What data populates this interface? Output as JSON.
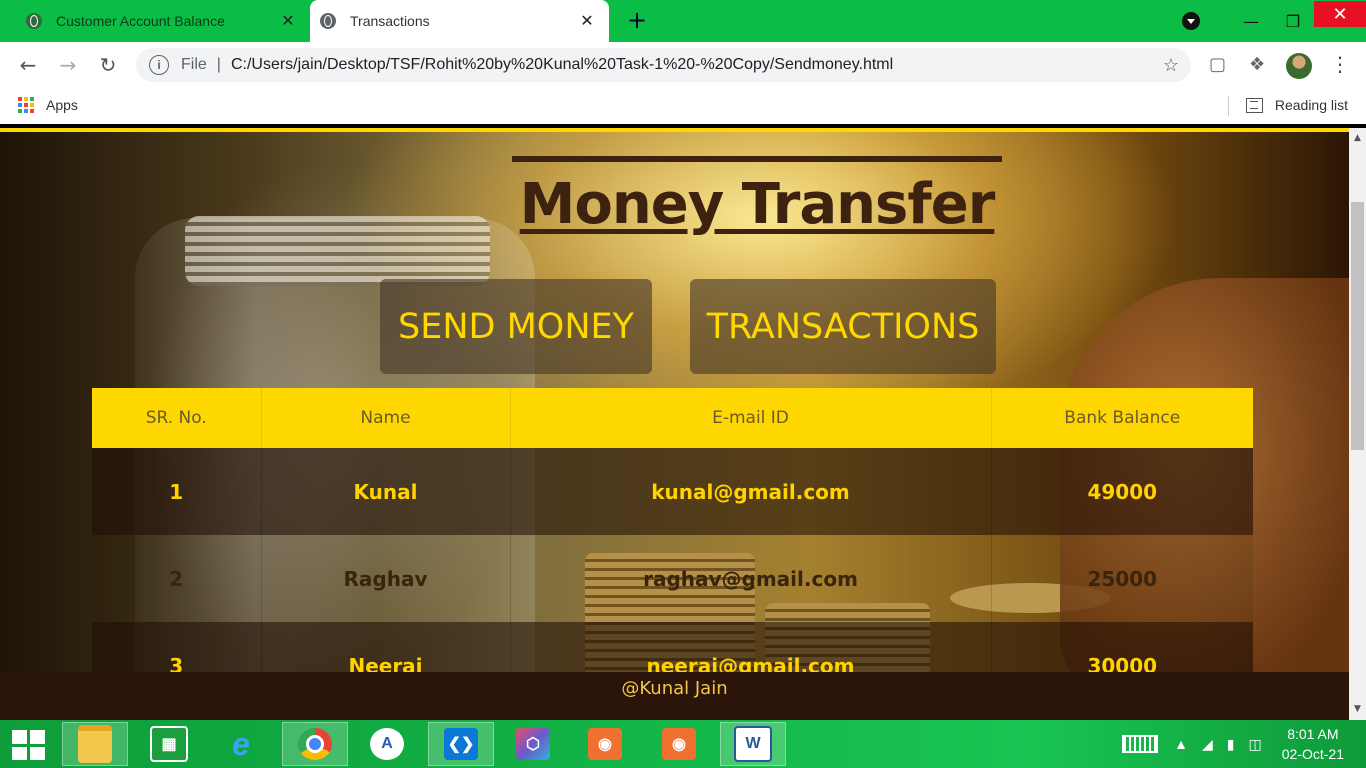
{
  "browser": {
    "tabs": [
      {
        "title": "Customer Account Balance",
        "close": "✕"
      },
      {
        "title": "Transactions",
        "close": "✕"
      }
    ],
    "new_tab": "+",
    "address": {
      "scheme_label": "File",
      "separator": "|",
      "url": "C:/Users/jain/Desktop/TSF/Rohit%20by%20Kunal%20Task-1%20-%20Copy/Sendmoney.html"
    },
    "bookmarks": {
      "apps_label": "Apps",
      "reading_list_label": "Reading list"
    }
  },
  "page": {
    "title": "Money Transfer",
    "buttons": {
      "send_money": "SEND MONEY",
      "transactions": "TRANSACTIONS"
    },
    "table": {
      "headers": [
        "SR. No.",
        "Name",
        "E-mail ID",
        "Bank Balance"
      ],
      "rows": [
        {
          "sr": "1",
          "name": "Kunal",
          "email": "kunal@gmail.com",
          "balance": "49000"
        },
        {
          "sr": "2",
          "name": "Raghav",
          "email": "raghav@gmail.com",
          "balance": "25000"
        },
        {
          "sr": "3",
          "name": "Neeraj",
          "email": "neeraj@gmail.com",
          "balance": "30000"
        }
      ]
    },
    "footer": "@Kunal Jain"
  },
  "taskbar": {
    "apps": [
      "file-explorer",
      "store",
      "internet-explorer",
      "chrome",
      "android-studio",
      "vscode",
      "3d-builder",
      "camera",
      "camera-2",
      "word"
    ],
    "time": "8:01 AM",
    "date": "02-Oct-21"
  },
  "colors": {
    "accent_yellow": "#ffd700",
    "title_brown": "#3e2210",
    "footer_bg": "#2b140a",
    "chrome_green": "#0bbd44"
  }
}
